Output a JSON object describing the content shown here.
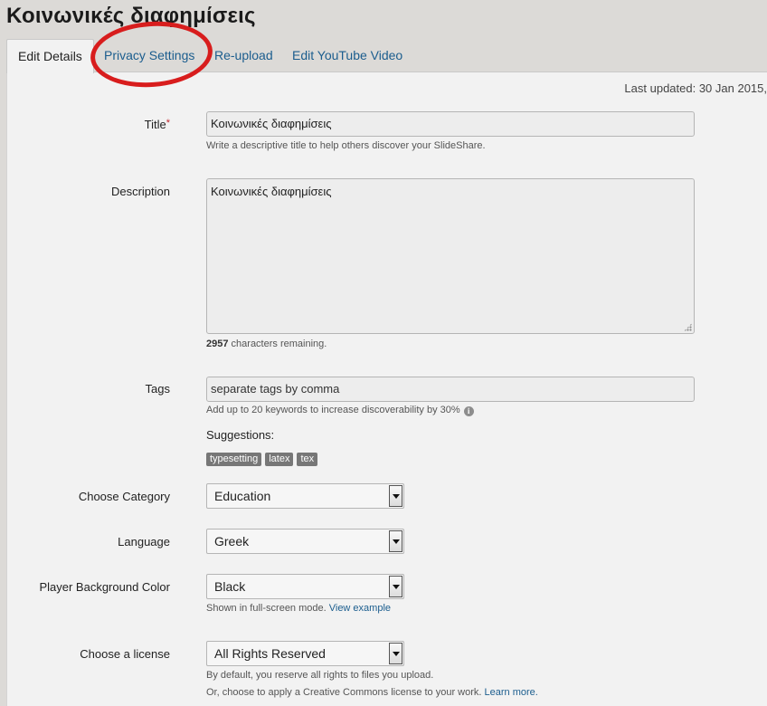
{
  "page": {
    "title": "Κοινωνικές διαφημίσεις"
  },
  "tabs": [
    {
      "label": "Edit Details",
      "active": true
    },
    {
      "label": "Privacy Settings"
    },
    {
      "label": "Re-upload"
    },
    {
      "label": "Edit YouTube Video"
    }
  ],
  "meta": {
    "last_updated": "Last updated: 30 Jan 2015,"
  },
  "form": {
    "title": {
      "label": "Title",
      "required_mark": "*",
      "value": "Κοινωνικές διαφημίσεις",
      "hint": "Write a descriptive title to help others discover your SlideShare."
    },
    "description": {
      "label": "Description",
      "value": "Κοινωνικές διαφημίσεις",
      "remaining_count": "2957",
      "remaining_text": " characters remaining."
    },
    "tags": {
      "label": "Tags",
      "placeholder": "separate tags by comma",
      "hint": "Add up to 20 keywords to increase discoverability by 30%",
      "suggestions_label": "Suggestions:",
      "suggestions": [
        "typesetting",
        "latex",
        "tex"
      ]
    },
    "category": {
      "label": "Choose Category",
      "selected": "Education"
    },
    "language": {
      "label": "Language",
      "selected": "Greek"
    },
    "player_bg": {
      "label": "Player Background Color",
      "selected": "Black",
      "hint": "Shown in full-screen mode. ",
      "hint_link": "View example"
    },
    "license": {
      "label": "Choose a license",
      "selected": "All Rights Reserved",
      "hint1": "By default, you reserve all rights to files you upload.",
      "hint2": "Or, choose to apply a Creative Commons license to your work. ",
      "hint2_link": "Learn more."
    }
  },
  "annotation": {
    "color": "#d81d1d"
  }
}
